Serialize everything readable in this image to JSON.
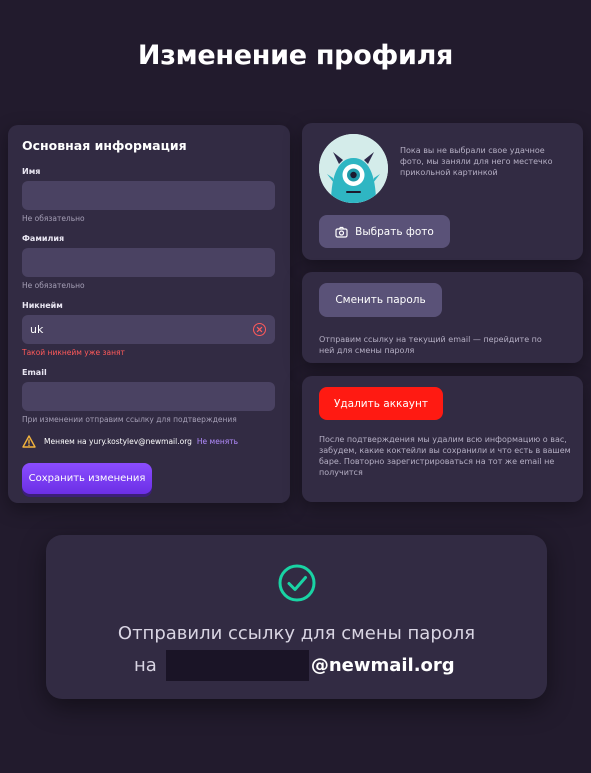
{
  "page": {
    "title": "Изменение профиля"
  },
  "main_info": {
    "title": "Основная информация",
    "first_name": {
      "label": "Имя",
      "value": "",
      "hint": "Не обязательно"
    },
    "last_name": {
      "label": "Фамилия",
      "value": "",
      "hint": "Не обязательно"
    },
    "nickname": {
      "label": "Никнейм",
      "value": "uk",
      "error": "Такой никнейм уже занят"
    },
    "email": {
      "label": "Email",
      "value": "",
      "hint": "При изменении отправим ссылку для подтверждения"
    },
    "pending_change": {
      "text": "Меняем на yury.kostylev@newmail.org",
      "cancel_link": "Не менять"
    },
    "save_button": "Сохранить изменения"
  },
  "photo": {
    "text": "Пока вы не выбрали свое удачное фото, мы заняли для него местечко прикольной картинкой",
    "button": "Выбрать фото",
    "icon": "camera-icon"
  },
  "password": {
    "button": "Сменить пароль",
    "text": "Отправим ссылку на текущий email — перейдите по ней для смены пароля"
  },
  "delete_account": {
    "button": "Удалить аккаунт",
    "text": "После подтверждения мы удалим всю информацию о вас, забудем, какие коктейли вы сохранили и что есть в вашем баре. Повторно зарегистрироваться на тот же email не получится"
  },
  "toast": {
    "line1": "Отправили ссылку для смены пароля",
    "prefix": "на",
    "domain": "@newmail.org",
    "icon": "check-circle-icon"
  },
  "colors": {
    "background": "#221b2d",
    "card": "#322b43",
    "input": "#4a4262",
    "accent_purple": "#8b4dff",
    "danger": "#ff1a12",
    "error_text": "#ff5a5a",
    "success": "#19d3a4"
  }
}
